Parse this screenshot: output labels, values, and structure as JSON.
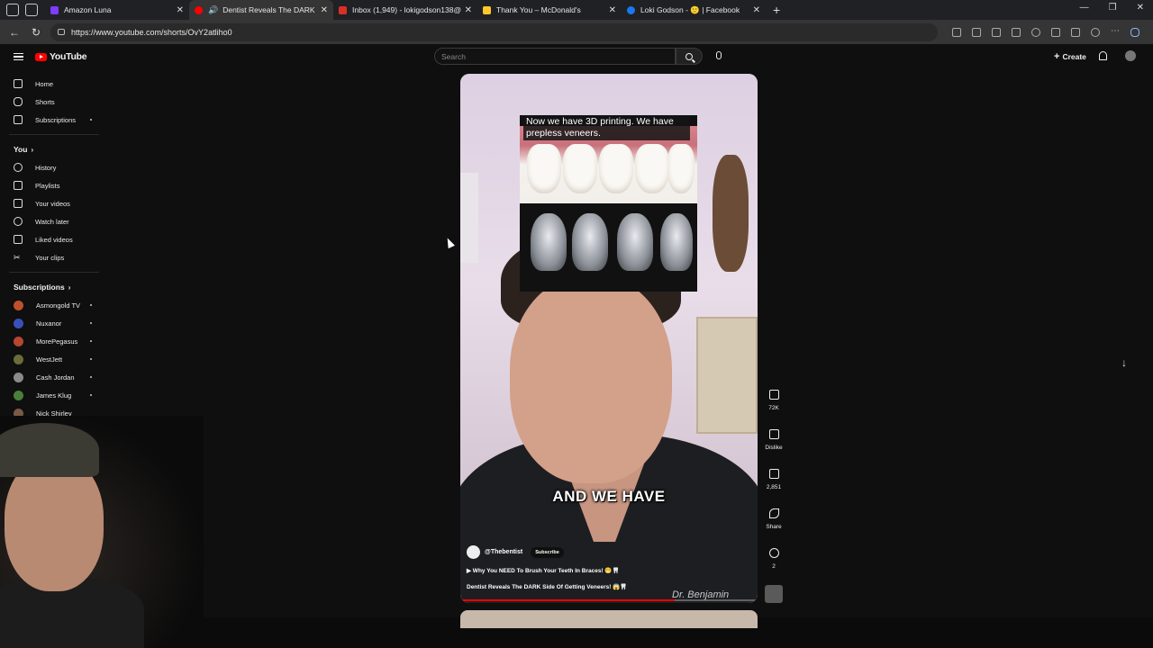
{
  "browser": {
    "tabs": [
      {
        "title": "Amazon Luna",
        "favicon_color": "#7d3cff",
        "active": false
      },
      {
        "title": "Dentist Reveals The DARK Si",
        "favicon_color": "#ff0000",
        "active": true
      },
      {
        "title": "Inbox (1,949) - lokigodson138@g",
        "favicon_color": "#d93025",
        "active": false
      },
      {
        "title": "Thank You – McDonald's",
        "favicon_color": "#ffc72c",
        "active": false
      },
      {
        "title": "Loki Godson - 🙂 | Facebook",
        "favicon_color": "#1877f2",
        "active": false
      }
    ],
    "url": "https://www.youtube.com/shorts/OvY2atliho0"
  },
  "youtube": {
    "logo": "YouTube",
    "search_placeholder": "Search",
    "create_label": "Create"
  },
  "sidebar": {
    "main": [
      {
        "label": "Home",
        "icon": "home-icon"
      },
      {
        "label": "Shorts",
        "icon": "shorts-icon"
      },
      {
        "label": "Subscriptions",
        "icon": "subscriptions-icon"
      }
    ],
    "you_heading": "You",
    "you_items": [
      {
        "label": "History",
        "icon": "history-icon"
      },
      {
        "label": "Playlists",
        "icon": "playlists-icon"
      },
      {
        "label": "Your videos",
        "icon": "your-videos-icon"
      },
      {
        "label": "Watch later",
        "icon": "watch-later-icon"
      },
      {
        "label": "Liked videos",
        "icon": "liked-videos-icon"
      },
      {
        "label": "Your clips",
        "icon": "scissors-icon"
      }
    ],
    "subs_heading": "Subscriptions",
    "subscriptions": [
      {
        "label": "Asmongold TV",
        "color": "#c0502d"
      },
      {
        "label": "Nuxanor",
        "color": "#3a4fb8"
      },
      {
        "label": "MorePegasus",
        "color": "#b7462f"
      },
      {
        "label": "WestJett",
        "color": "#6b6b3d"
      },
      {
        "label": "Cash Jordan",
        "color": "#8a8a8a"
      },
      {
        "label": "James Klug",
        "color": "#4a7f3a"
      },
      {
        "label": "Nick Shirley",
        "color": "#7b5a45"
      }
    ]
  },
  "short": {
    "top_caption": "Now we have 3D printing. We have prepless veneers.",
    "big_caption": "AND WE HAVE",
    "channel": "@Thebentist",
    "subscribe": "Subscribe",
    "related": "▶ Why You NEED To Brush Your Teeth In Braces! 😬🦷",
    "title": "Dentist Reveals The DARK Side Of Getting Veneers! 😱🦷",
    "watermark": "Dr. Benjamin",
    "progress": 0.72
  },
  "actions": [
    {
      "label": "72K",
      "icon": "like-icon"
    },
    {
      "label": "Dislike",
      "icon": "dislike-icon"
    },
    {
      "label": "2,851",
      "icon": "comment-icon"
    },
    {
      "label": "Share",
      "icon": "share-icon"
    },
    {
      "label": "2",
      "icon": "remix-icon"
    }
  ]
}
